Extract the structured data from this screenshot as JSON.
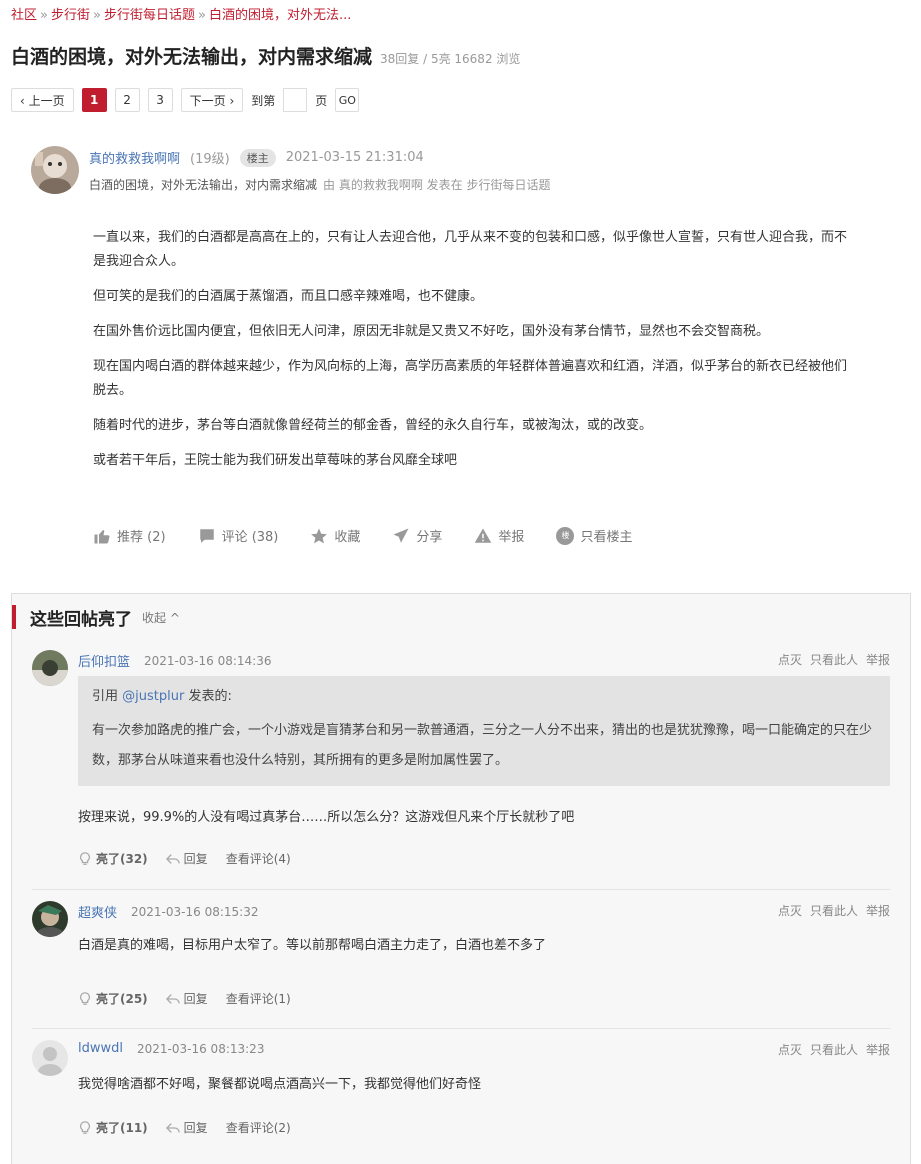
{
  "breadcrumb": {
    "items": [
      "社区",
      "步行街",
      "步行街每日话题",
      "白酒的困境，对外无法..."
    ],
    "sep": "»"
  },
  "thread": {
    "title": "白酒的困境，对外无法输出，对内需求缩减",
    "stats": "38回复 / 5亮 16682 浏览"
  },
  "pager": {
    "prev": "‹ 上一页",
    "pages": [
      "1",
      "2",
      "3"
    ],
    "next": "下一页 ›",
    "goto_label": "到第",
    "page_unit": "页",
    "go": "GO"
  },
  "op": {
    "author": "真的救救我啊啊",
    "level": "(19级)",
    "badge": "楼主",
    "time": "2021-03-15 21:31:04",
    "subtitle": "白酒的困境，对外无法输出，对内需求缩减",
    "by": "由 真的救救我啊啊 发表在 步行街每日话题",
    "paragraphs": [
      "一直以来，我们的白酒都是高高在上的，只有让人去迎合他，几乎从来不变的包装和口感，似乎像世人宣誓，只有世人迎合我，而不是我迎合众人。",
      "但可笑的是我们的白酒属于蒸馏酒，而且口感辛辣难喝，也不健康。",
      "在国外售价远比国内便宜，但依旧无人问津，原因无非就是又贵又不好吃，国外没有茅台情节，显然也不会交智商税。",
      "现在国内喝白酒的群体越来越少，作为风向标的上海，高学历高素质的年轻群体普遍喜欢和红酒，洋酒，似乎茅台的新衣已经被他们脱去。",
      "随着时代的进步，茅台等白酒就像曾经荷兰的郁金香，曾经的永久自行车，或被淘汰，或的改变。",
      "或者若干年后，王院士能为我们研发出草莓味的茅台风靡全球吧"
    ],
    "actions": {
      "recommend": "推荐 (2)",
      "comment": "评论 (38)",
      "favorite": "收藏",
      "share": "分享",
      "report": "举报",
      "only_op": "只看楼主",
      "only_op_icon_text": "楼"
    }
  },
  "hot_replies": {
    "heading": "这些回帖亮了",
    "fold": "收起 ^",
    "ops": [
      "点灭",
      "只看此人",
      "举报"
    ],
    "reply_label": "回复",
    "items": [
      {
        "author": "后仰扣篮",
        "time": "2021-03-16 08:14:36",
        "quote_prefix": "引用 ",
        "quote_user": "@justplur",
        "quote_suffix": " 发表的:",
        "quote_text": "有一次参加路虎的推广会，一个小游戏是盲猜茅台和另一款普通酒，三分之一人分不出来，猜出的也是犹犹豫豫，喝一口能确定的只在少数，那茅台从味道来看也没什么特别，其所拥有的更多是附加属性罢了。",
        "text": "按理来说，99.9%的人没有喝过真茅台……所以怎么分？这游戏但凡来个厅长就秒了吧",
        "light": "亮了(32)",
        "comments": "查看评论(4)"
      },
      {
        "author": "超爽侠",
        "time": "2021-03-16 08:15:32",
        "text": "白酒是真的难喝，目标用户太窄了。等以前那帮喝白酒主力走了，白酒也差不多了",
        "light": "亮了(25)",
        "comments": "查看评论(1)"
      },
      {
        "author": "ldwwdl",
        "time": "2021-03-16 08:13:23",
        "text": "我觉得啥酒都不好喝，聚餐都说喝点酒高兴一下，我都觉得他们好奇怪",
        "light": "亮了(11)",
        "comments": "查看评论(2)"
      }
    ]
  },
  "colors": {
    "accent": "#c01e2f",
    "link": "#4a75b5"
  }
}
